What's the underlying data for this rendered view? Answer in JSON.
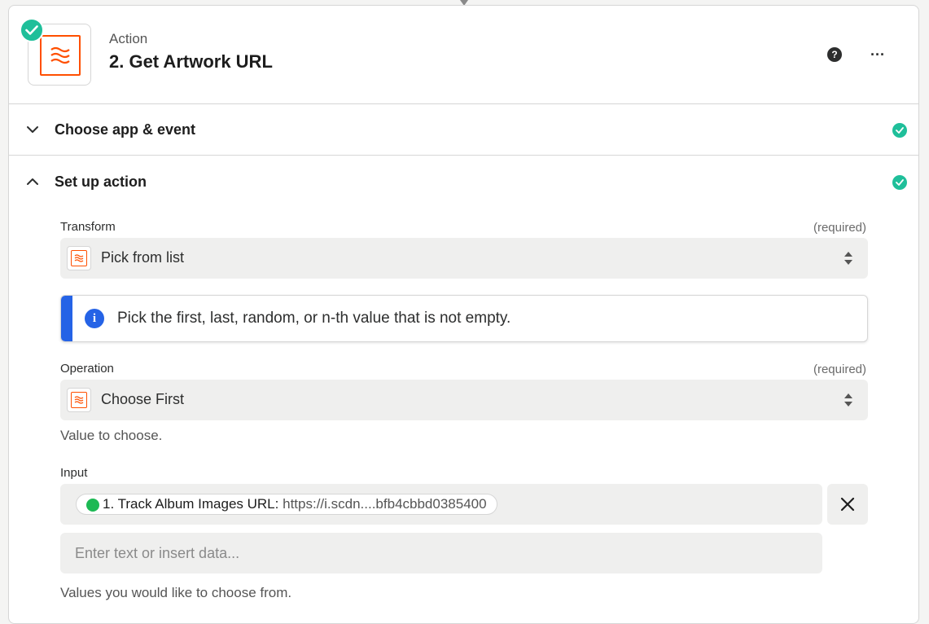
{
  "step": {
    "kicker": "Action",
    "title": "2. Get Artwork URL",
    "icons": {
      "app": "formatter-icon",
      "status": "check-icon",
      "help": "help-icon",
      "more": "more-icon"
    }
  },
  "sections": {
    "choose_app": {
      "title": "Choose app & event",
      "expanded": false,
      "complete": true
    },
    "setup": {
      "title": "Set up action",
      "expanded": true,
      "complete": true
    }
  },
  "fields": {
    "transform": {
      "label": "Transform",
      "required": "(required)",
      "value": "Pick from list"
    },
    "info": {
      "text": "Pick the first, last, random, or n-th value that is not empty."
    },
    "operation": {
      "label": "Operation",
      "required": "(required)",
      "value": "Choose First",
      "help": "Value to choose."
    },
    "input": {
      "label": "Input",
      "token": {
        "app_icon": "spotify-icon",
        "label": "1. Track Album Images URL:",
        "value": "https://i.scdn....bfb4cbbd0385400"
      },
      "placeholder": "Enter text or insert data...",
      "help": "Values you would like to choose from."
    }
  },
  "colors": {
    "accent": "#ff4f00",
    "success": "#1fbf9a",
    "info": "#2563e6",
    "spotify": "#1db954"
  }
}
